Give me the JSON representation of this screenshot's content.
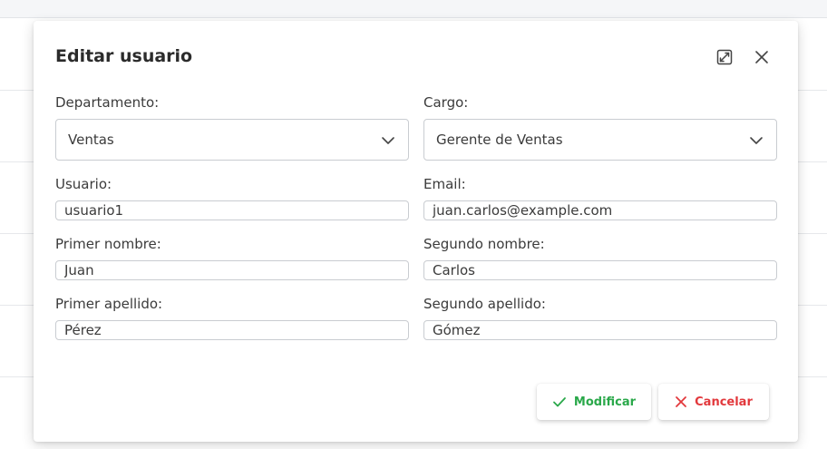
{
  "modal": {
    "title": "Editar usuario",
    "expand_icon": "expand-icon",
    "close_icon": "close-icon"
  },
  "form": {
    "department": {
      "label": "Departamento:",
      "value": "Ventas"
    },
    "position": {
      "label": "Cargo:",
      "value": "Gerente de Ventas"
    },
    "username": {
      "label": "Usuario:",
      "value": "usuario1"
    },
    "email": {
      "label": "Email:",
      "value": "juan.carlos@example.com"
    },
    "first_name": {
      "label": "Primer nombre:",
      "value": "Juan"
    },
    "middle_name": {
      "label": "Segundo nombre:",
      "value": "Carlos"
    },
    "first_surname": {
      "label": "Primer apellido:",
      "value": "Pérez"
    },
    "second_surname": {
      "label": "Segundo apellido:",
      "value": "Gómez"
    }
  },
  "actions": {
    "modify_label": "Modificar",
    "cancel_label": "Cancelar"
  },
  "colors": {
    "modify": "#2aa84a",
    "cancel": "#e2383c",
    "border": "#c9ccd1"
  }
}
